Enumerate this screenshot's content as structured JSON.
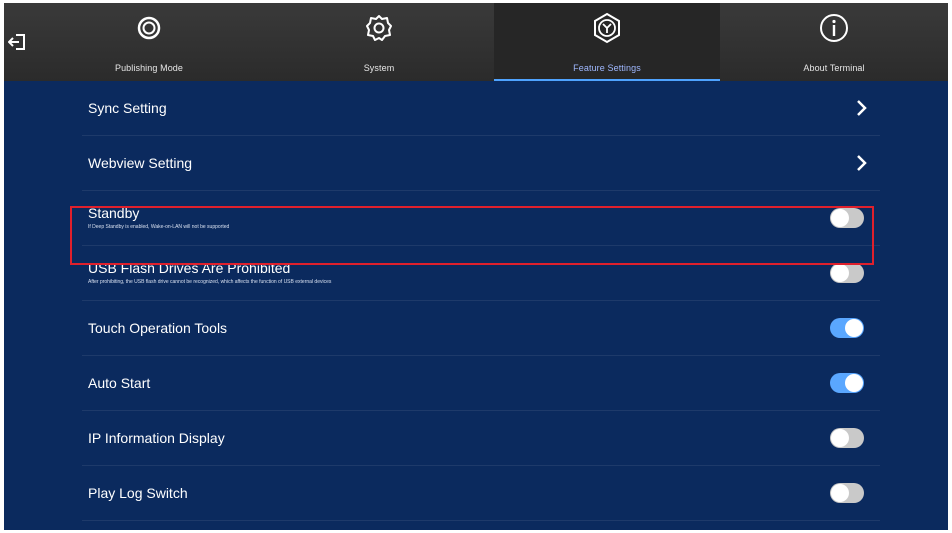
{
  "tabs": [
    {
      "label": "Publishing Mode",
      "icon": "publishing-mode-icon",
      "active": false
    },
    {
      "label": "System",
      "icon": "gear-icon",
      "active": false
    },
    {
      "label": "Feature Settings",
      "icon": "feature-settings-icon",
      "active": true
    },
    {
      "label": "About Terminal",
      "icon": "info-icon",
      "active": false
    }
  ],
  "settings": [
    {
      "title": "Sync Setting",
      "control": "chevron"
    },
    {
      "title": "Webview Setting",
      "control": "chevron"
    },
    {
      "title": "Standby",
      "description": "If Deep Standby is enabled, Wake-on-LAN will not be supported",
      "control": "toggle",
      "on": false,
      "highlighted": true
    },
    {
      "title": "USB Flash Drives Are Prohibited",
      "description": "After prohibiting, the USB flash drive cannot be recognized, which affects the function of USB external devices",
      "control": "toggle",
      "on": false
    },
    {
      "title": "Touch Operation Tools",
      "control": "toggle",
      "on": true
    },
    {
      "title": "Auto Start",
      "control": "toggle",
      "on": true
    },
    {
      "title": "IP Information Display",
      "control": "toggle",
      "on": false
    },
    {
      "title": "Play Log Switch",
      "control": "toggle",
      "on": false
    }
  ],
  "colors": {
    "background": "#0b2a5e",
    "topbar": "#2b2b2b",
    "accent": "#5aa7ff",
    "highlight": "#e0202c"
  }
}
